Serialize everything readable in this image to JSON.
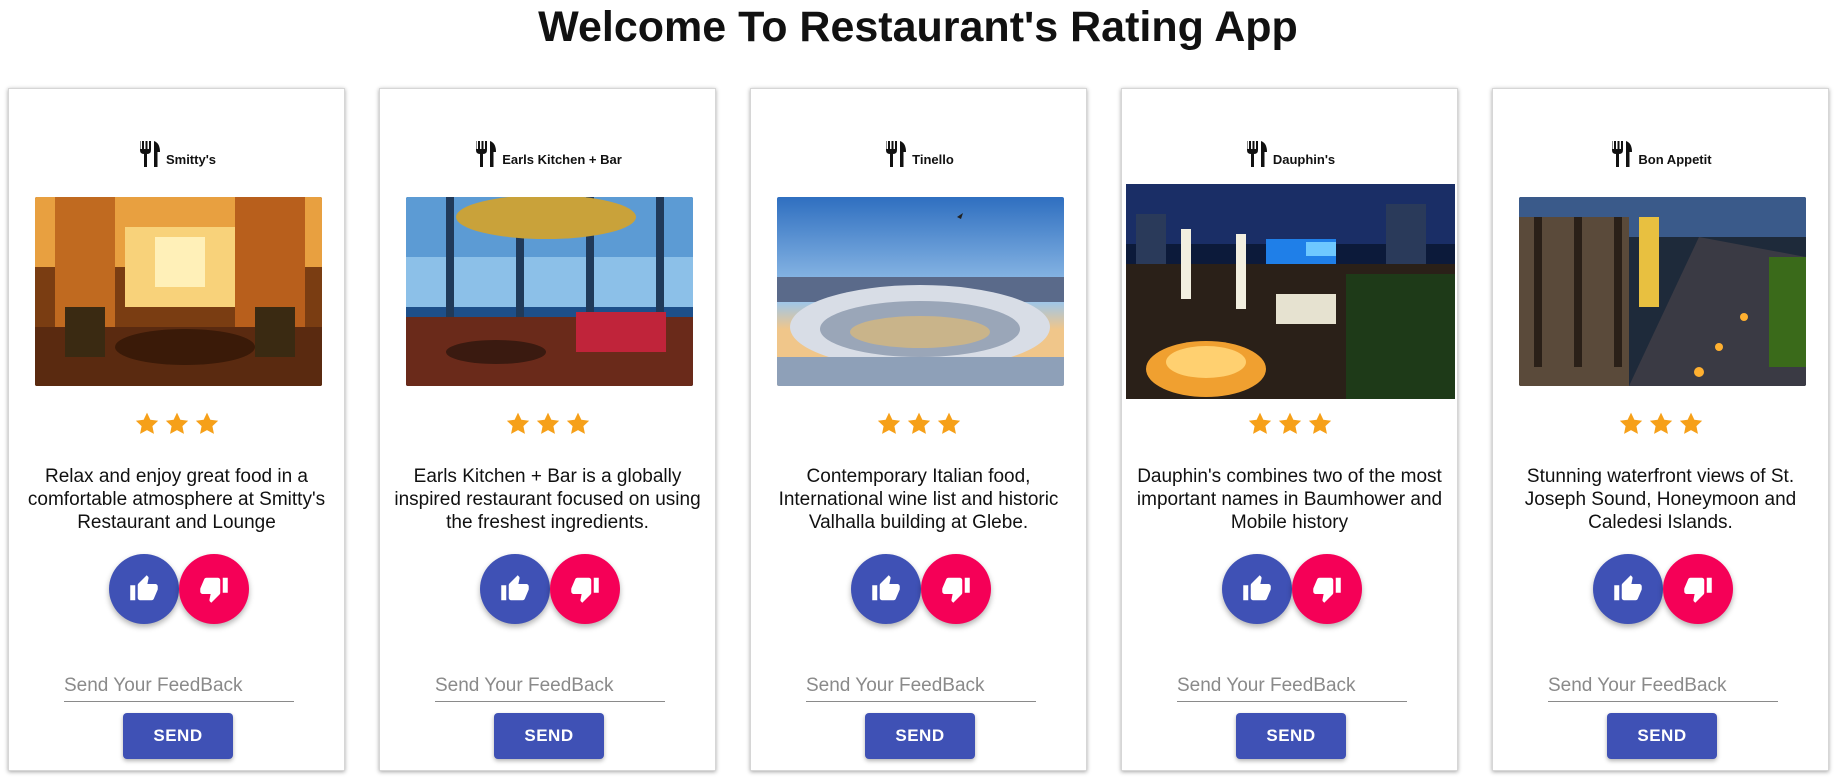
{
  "app": {
    "title": "Welcome To Restaurant's Rating App"
  },
  "colors": {
    "like": "#3f51b5",
    "dislike": "#f50057",
    "send": "#3f51b5",
    "star": "#f6a019"
  },
  "restaurants": [
    {
      "name": "Smitty's",
      "photo": "restaurant-interior-photo",
      "rating": 3,
      "description": "Relax and enjoy great food in a comfortable atmosphere at Smitty's Restaurant and Lounge",
      "feedback_placeholder": "Send Your FeedBack",
      "feedback_value": "",
      "send_label": "SEND"
    },
    {
      "name": "Earls Kitchen + Bar",
      "photo": "restaurant-interior-photo",
      "rating": 3,
      "description": "Earls Kitchen + Bar is a globally inspired restaurant focused on using the freshest ingredients.",
      "feedback_placeholder": "Send Your FeedBack",
      "feedback_value": "",
      "send_label": "SEND"
    },
    {
      "name": "Tinello",
      "photo": "rooftop-lounge-photo",
      "rating": 3,
      "description": "Contemporary Italian food, International wine list and historic Valhalla building at Glebe.",
      "feedback_placeholder": "Send Your FeedBack",
      "feedback_value": "",
      "send_label": "SEND"
    },
    {
      "name": "Dauphin's",
      "photo": "rooftop-night-photo",
      "rating": 3,
      "description": "Dauphin's combines two of the most important names in Baumhower and Mobile history",
      "feedback_placeholder": "Send Your FeedBack",
      "feedback_value": "",
      "send_label": "SEND"
    },
    {
      "name": "Bon Appetit",
      "photo": "waterfront-terrace-photo",
      "rating": 3,
      "description": "Stunning waterfront views of St. Joseph Sound, Honeymoon and Caledesi Islands.",
      "feedback_placeholder": "Send Your FeedBack",
      "feedback_value": "",
      "send_label": "SEND"
    }
  ]
}
